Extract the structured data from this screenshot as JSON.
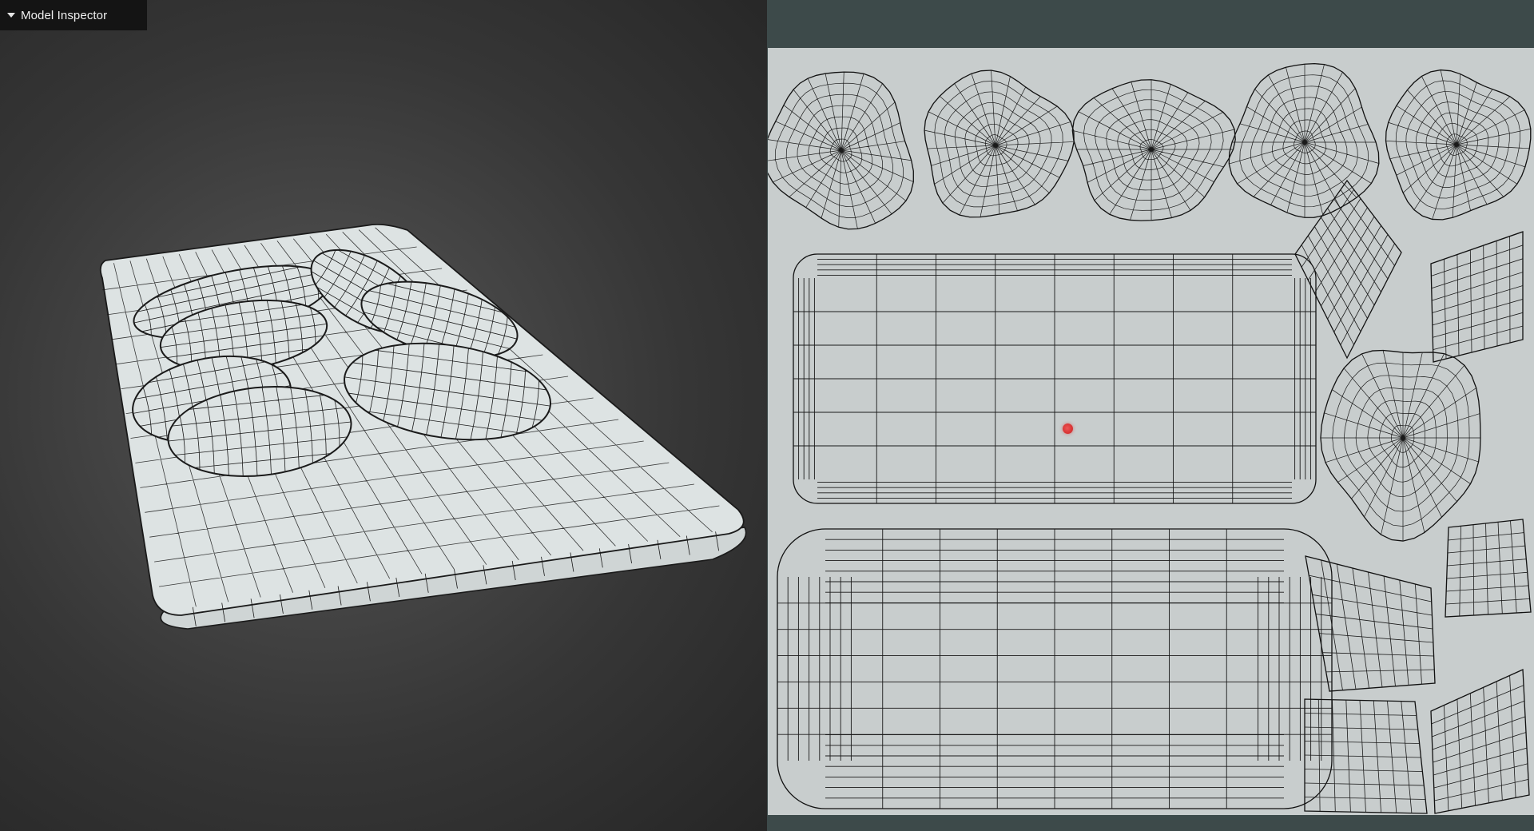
{
  "app": {
    "inspector_title": "Model Inspector",
    "icons": {
      "collapse": "caret-down-icon"
    }
  },
  "viewport": {
    "shading": "wireframe",
    "background_color": "#3c3c3c",
    "mesh_fill_color": "#dde3e3",
    "wire_color": "#1a1a1a"
  },
  "uv_editor": {
    "background_color": "#c8cdcd",
    "border_color": "#3d4a4a",
    "cursor_color": "#d83535",
    "island_count": 14
  }
}
